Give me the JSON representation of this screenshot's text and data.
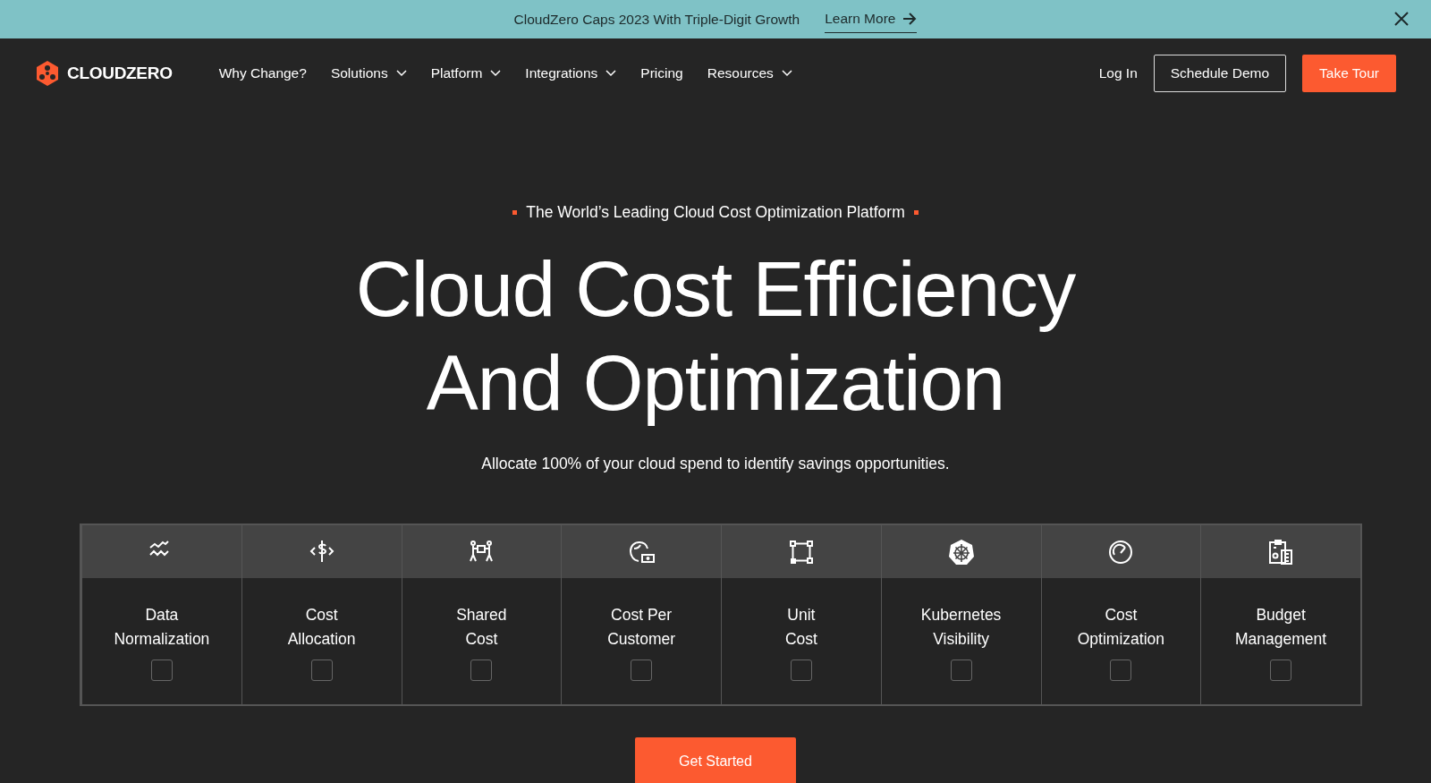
{
  "banner": {
    "message": "CloudZero Caps 2023 With Triple-Digit Growth",
    "link": "Learn More"
  },
  "nav": {
    "logo": "CLOUDZERO",
    "items": [
      {
        "label": "Why Change?",
        "dropdown": false
      },
      {
        "label": "Solutions",
        "dropdown": true
      },
      {
        "label": "Platform",
        "dropdown": true
      },
      {
        "label": "Integrations",
        "dropdown": true
      },
      {
        "label": "Pricing",
        "dropdown": false
      },
      {
        "label": "Resources",
        "dropdown": true
      }
    ],
    "login": "Log In",
    "demo": "Schedule Demo",
    "tour": "Take Tour"
  },
  "hero": {
    "eyebrow": "The World’s Leading Cloud Cost Optimization Platform",
    "title_lines": [
      "Cloud Cost Efficiency",
      "And Optimization"
    ],
    "subtitle": "Allocate 100% of your cloud spend to identify savings opportunities."
  },
  "features": [
    {
      "kind": "normalization",
      "lines": [
        "Data",
        "Normalization"
      ],
      "checked": false
    },
    {
      "kind": "allocation",
      "lines": [
        "Cost",
        "Allocation"
      ],
      "checked": false
    },
    {
      "kind": "shared",
      "lines": [
        "Shared",
        "Cost"
      ],
      "checked": false
    },
    {
      "kind": "customer",
      "lines": [
        "Cost Per",
        "Customer"
      ],
      "checked": false
    },
    {
      "kind": "unit",
      "lines": [
        "Unit",
        "Cost"
      ],
      "checked": false
    },
    {
      "kind": "kubernetes",
      "lines": [
        "Kubernetes",
        "Visibility"
      ],
      "checked": false
    },
    {
      "kind": "optimization",
      "lines": [
        "Cost",
        "Optimization"
      ],
      "checked": false
    },
    {
      "kind": "budget",
      "lines": [
        "Budget",
        "Management"
      ],
      "checked": false
    }
  ],
  "cta": "Get Started"
}
